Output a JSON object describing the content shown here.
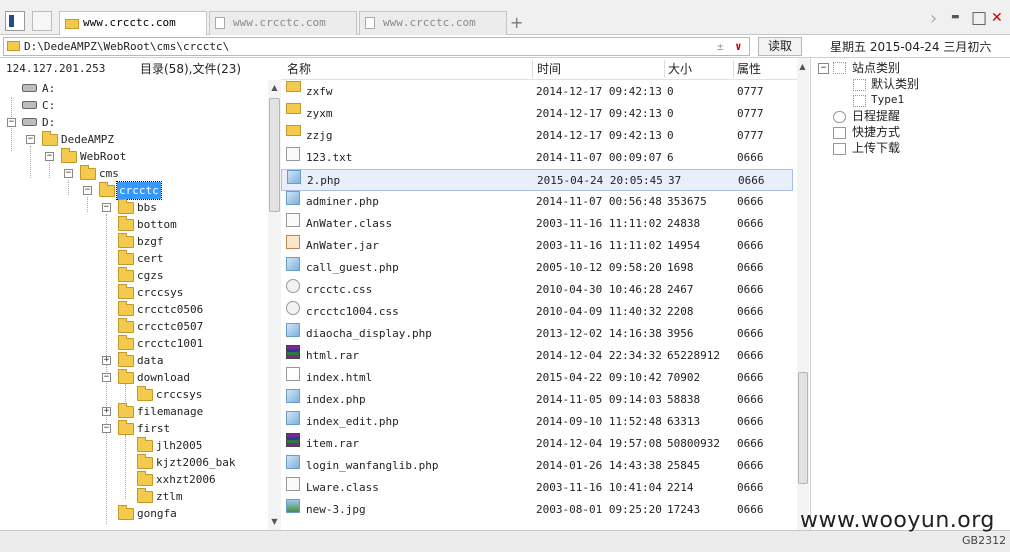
{
  "tabs": [
    {
      "label": "www.crcctc.com",
      "active": true
    },
    {
      "label": "www.crcctc.com",
      "active": false
    },
    {
      "label": "www.crcctc.com",
      "active": false
    }
  ],
  "window": {
    "new_tab": "+",
    "nav_arrow": "›",
    "minimize": "▬",
    "maximize": "□",
    "close": "✕"
  },
  "address": {
    "path": "D:\\DedeAMPZ\\WebRoot\\cms\\crcctc\\",
    "read_label": "读取",
    "date": "星期五 2015-04-24 三月初六",
    "ctl1": "±",
    "ctl2": "∨"
  },
  "left": {
    "ip": "124.127.201.253",
    "summary": "目录(58),文件(23)",
    "tree": [
      {
        "label": "A:",
        "type": "drive"
      },
      {
        "label": "C:",
        "type": "drive"
      },
      {
        "label": "D:",
        "type": "drive"
      },
      {
        "label": "DedeAMPZ",
        "type": "folder"
      },
      {
        "label": "WebRoot",
        "type": "folder"
      },
      {
        "label": "cms",
        "type": "folder"
      },
      {
        "label": "crcctc",
        "type": "folder"
      },
      {
        "label": "bbs",
        "type": "folder"
      },
      {
        "label": "bottom",
        "type": "folder"
      },
      {
        "label": "bzgf",
        "type": "folder"
      },
      {
        "label": "cert",
        "type": "folder"
      },
      {
        "label": "cgzs",
        "type": "folder"
      },
      {
        "label": "crccsys",
        "type": "folder"
      },
      {
        "label": "crcctc0506",
        "type": "folder"
      },
      {
        "label": "crcctc0507",
        "type": "folder"
      },
      {
        "label": "crcctc1001",
        "type": "folder"
      },
      {
        "label": "data",
        "type": "folder"
      },
      {
        "label": "download",
        "type": "folder"
      },
      {
        "label": "crccsys",
        "type": "folder"
      },
      {
        "label": "filemanage",
        "type": "folder"
      },
      {
        "label": "first",
        "type": "folder"
      },
      {
        "label": "jlh2005",
        "type": "folder"
      },
      {
        "label": "kjzt2006_bak",
        "type": "folder"
      },
      {
        "label": "xxhzt2006",
        "type": "folder"
      },
      {
        "label": "ztlm",
        "type": "folder"
      },
      {
        "label": "gongfa",
        "type": "folder"
      }
    ],
    "expanders": [
      "−",
      "−",
      "−",
      "−",
      "−",
      "−",
      "+",
      "+",
      "−",
      "+",
      "−"
    ],
    "scroll_up": "▲",
    "scroll_down": "▼"
  },
  "files": {
    "columns": {
      "name": "名称",
      "time": "时间",
      "size": "大小",
      "attr": "属性"
    },
    "rows": [
      {
        "name": "zxfw",
        "time": "2014-12-17 09:42:13",
        "size": "0",
        "attr": "0777",
        "icon": "folder"
      },
      {
        "name": "zyxm",
        "time": "2014-12-17 09:42:13",
        "size": "0",
        "attr": "0777",
        "icon": "folder"
      },
      {
        "name": "zzjg",
        "time": "2014-12-17 09:42:13",
        "size": "0",
        "attr": "0777",
        "icon": "folder"
      },
      {
        "name": "123.txt",
        "time": "2014-11-07 00:09:07",
        "size": "6",
        "attr": "0666",
        "icon": "file"
      },
      {
        "name": "2.php",
        "time": "2015-04-24 20:05:45",
        "size": "37",
        "attr": "0666",
        "icon": "php"
      },
      {
        "name": "adminer.php",
        "time": "2014-11-07 00:56:48",
        "size": "353675",
        "attr": "0666",
        "icon": "php"
      },
      {
        "name": "AnWater.class",
        "time": "2003-11-16 11:11:02",
        "size": "24838",
        "attr": "0666",
        "icon": "file"
      },
      {
        "name": "AnWater.jar",
        "time": "2003-11-16 11:11:02",
        "size": "14954",
        "attr": "0666",
        "icon": "jar"
      },
      {
        "name": "call_guest.php",
        "time": "2005-10-12 09:58:20",
        "size": "1698",
        "attr": "0666",
        "icon": "php"
      },
      {
        "name": "crcctc.css",
        "time": "2010-04-30 10:46:28",
        "size": "2467",
        "attr": "0666",
        "icon": "css"
      },
      {
        "name": "crcctc1004.css",
        "time": "2010-04-09 11:40:32",
        "size": "2208",
        "attr": "0666",
        "icon": "css"
      },
      {
        "name": "diaocha_display.php",
        "time": "2013-12-02 14:16:38",
        "size": "3956",
        "attr": "0666",
        "icon": "php"
      },
      {
        "name": "html.rar",
        "time": "2014-12-04 22:34:32",
        "size": "65228912",
        "attr": "0666",
        "icon": "rar"
      },
      {
        "name": "index.html",
        "time": "2015-04-22 09:10:42",
        "size": "70902",
        "attr": "0666",
        "icon": "html"
      },
      {
        "name": "index.php",
        "time": "2014-11-05 09:14:03",
        "size": "58838",
        "attr": "0666",
        "icon": "php"
      },
      {
        "name": "index_edit.php",
        "time": "2014-09-10 11:52:48",
        "size": "63313",
        "attr": "0666",
        "icon": "php"
      },
      {
        "name": "item.rar",
        "time": "2014-12-04 19:57:08",
        "size": "50800932",
        "attr": "0666",
        "icon": "rar"
      },
      {
        "name": "login_wanfanglib.php",
        "time": "2014-01-26 14:43:38",
        "size": "25845",
        "attr": "0666",
        "icon": "php"
      },
      {
        "name": "Lware.class",
        "time": "2003-11-16 10:41:04",
        "size": "2214",
        "attr": "0666",
        "icon": "file"
      },
      {
        "name": "new-3.jpg",
        "time": "2003-08-01 09:25:20",
        "size": "17243",
        "attr": "0666",
        "icon": "jpg"
      }
    ]
  },
  "right": {
    "items": [
      {
        "label": "站点类别",
        "box": "−"
      },
      {
        "label": "默认类别"
      },
      {
        "label": "Type1"
      },
      {
        "label": "日程提醒"
      },
      {
        "label": "快捷方式"
      },
      {
        "label": "上传下载"
      }
    ]
  },
  "status": {
    "watermark": "www.wooyun.org",
    "encoding": "GB2312"
  }
}
